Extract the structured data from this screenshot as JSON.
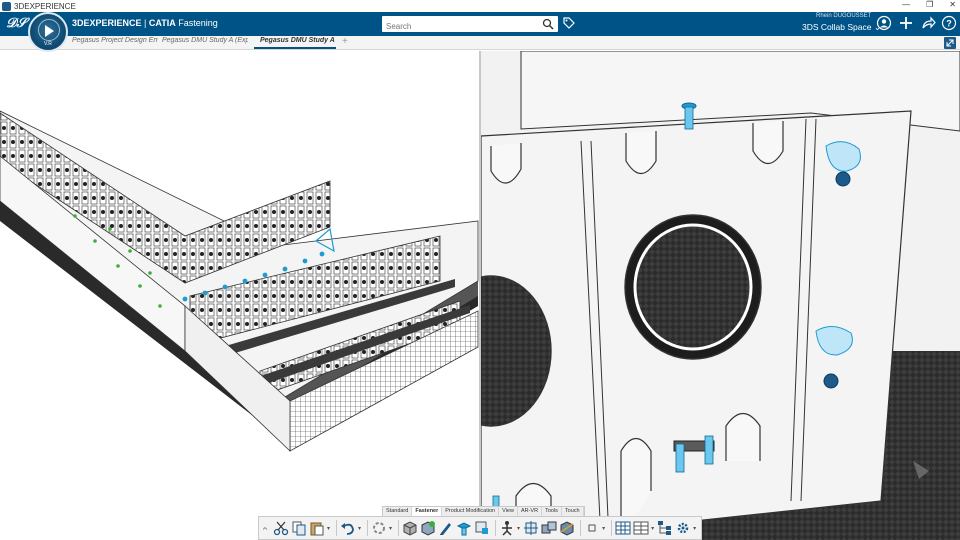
{
  "window": {
    "title": "3DEXPERIENCE"
  },
  "header": {
    "brand_bold": "3DEXPERIENCE",
    "brand_separator": " | ",
    "brand_catia": "CATIA",
    "brand_app": " Fastening",
    "search_placeholder": "Search",
    "user_name": "Rhein DUGOUSSET",
    "collab_space": "3DS Collab Space ⌄",
    "compass_label": "V.R"
  },
  "tabs": [
    {
      "label": "Pegasus Project Design Envi",
      "active": false
    },
    {
      "label": "Pegasus DMU Study A (Expl",
      "active": false
    },
    {
      "label": "Pegasus DMU Study A",
      "active": true
    }
  ],
  "tab_add": "+",
  "action_bar": {
    "tabs": [
      "Standard",
      "Fastener",
      "Product Modification",
      "View",
      "AR-VR",
      "Tools",
      "Touch"
    ],
    "active_tab": "Fastener",
    "buttons": [
      "collapse-icon",
      "cut-icon",
      "copy-icon",
      "paste-icon",
      "undo-icon",
      "update-icon",
      "3d-part-icon",
      "new-product-icon",
      "sketch-pen-icon",
      "fastener-icon",
      "fastener-edit-icon",
      "manipulator-icon",
      "move-icon",
      "group-icon",
      "section-icon",
      "display-icon",
      "table-icon",
      "table-options-icon",
      "tree-icon",
      "settings-icon"
    ]
  },
  "colors": {
    "header_bg": "#005386",
    "accent": "#1f9bd1",
    "fastener": "#2aa8e0",
    "green": "#3cae3c"
  }
}
